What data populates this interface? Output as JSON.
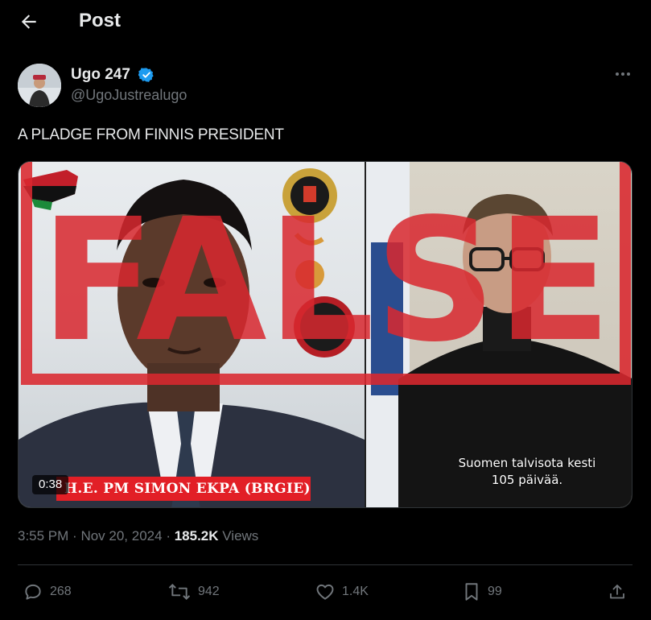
{
  "header": {
    "title": "Post",
    "back_icon": "arrow-left-icon"
  },
  "author": {
    "display_name": "Ugo 247",
    "handle": "@UgoJustrealugo",
    "verified": true,
    "verified_color": "#1d9bf0",
    "avatar_icon": "avatar"
  },
  "post": {
    "text": "A PLADGE FROM FINNIS PRESIDENT",
    "media": {
      "stamp_text": "FALSE",
      "stamp_color": "#d9282f",
      "lower_third": "H.E. PM SIMON EKPA (BRGIE)",
      "subtitle_line1": "Suomen talvisota kesti",
      "subtitle_line2": "105 päivää.",
      "duration": "0:38"
    },
    "time": "3:55 PM",
    "date": "Nov 20, 2024",
    "views_count": "185.2K",
    "views_label": "Views"
  },
  "actions": {
    "replies": "268",
    "reposts": "942",
    "likes": "1.4K",
    "bookmarks": "99"
  },
  "colors": {
    "background": "#000000",
    "text": "#e7e9ea",
    "muted": "#71767b",
    "border": "#2f3336"
  }
}
